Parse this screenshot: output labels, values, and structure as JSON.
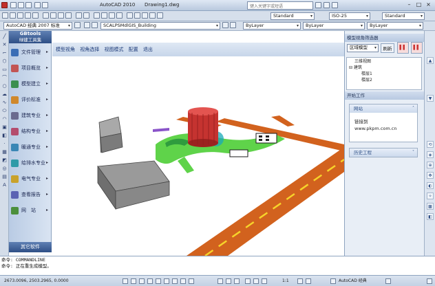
{
  "title": {
    "app_name": "AutoCAD 2010",
    "document": "Drawing1.dwg",
    "search_placeholder": "键入关键字或短语"
  },
  "toolbar": {
    "workspace": "AutoCAD 经典 2007 标准",
    "text_style": "Standard",
    "dim_style": "ISO-25",
    "table_style": "Standard",
    "layer": "SCALPSMdlGIS_Building",
    "color": "ByLayer",
    "linetype": "ByLayer",
    "lineweight": "ByLayer"
  },
  "gbtools": {
    "title": "GBtools",
    "subtitle": "绿建工具集",
    "items": [
      {
        "label": "文件管理",
        "icon": "file-icon",
        "color": "#3a6db5"
      },
      {
        "label": "项目概览",
        "icon": "project-icon",
        "color": "#c25454"
      },
      {
        "label": "模型建立",
        "icon": "model-icon",
        "color": "#3c8f4f"
      },
      {
        "label": "评价标准",
        "icon": "standard-icon",
        "color": "#d0882b"
      },
      {
        "label": "建筑专业",
        "icon": "building-icon",
        "color": "#6b6b8f"
      },
      {
        "label": "结构专业",
        "icon": "structure-icon",
        "color": "#b44c6e"
      },
      {
        "label": "暖通专业",
        "icon": "hvac-icon",
        "color": "#3a86b5"
      },
      {
        "label": "给排水专业",
        "icon": "water-icon",
        "color": "#2f9aa8"
      },
      {
        "label": "电气专业",
        "icon": "electric-icon",
        "color": "#c9a22c"
      },
      {
        "label": "查看报告",
        "icon": "report-icon",
        "color": "#5b63b3"
      },
      {
        "label": "网　站",
        "icon": "web-icon",
        "color": "#4c8f3c"
      }
    ],
    "footer": "其它软件"
  },
  "menustrip": [
    "模型视角",
    "视角选择",
    "视图模式",
    "配置",
    "退出"
  ],
  "right_panel": {
    "header": "模型视角筛选器",
    "mode_label": "区域模型",
    "btn_refresh": "刷新",
    "tree": [
      "三维视图",
      "建筑",
      "楼层1",
      "楼层2"
    ],
    "task_header": "开始工作",
    "web_header": "网站",
    "link_label": "链接到",
    "link_url": "www.pkpm.com.cn",
    "history_header": "历史工程"
  },
  "command": {
    "line1": "命令: COMMANDLINE",
    "line2": "命令: 正在重生成模型。"
  },
  "status": {
    "coords": "2673.0096, 2503.2965, 0.0000",
    "app": "AutoCAD 经典",
    "scale": "1:1"
  }
}
